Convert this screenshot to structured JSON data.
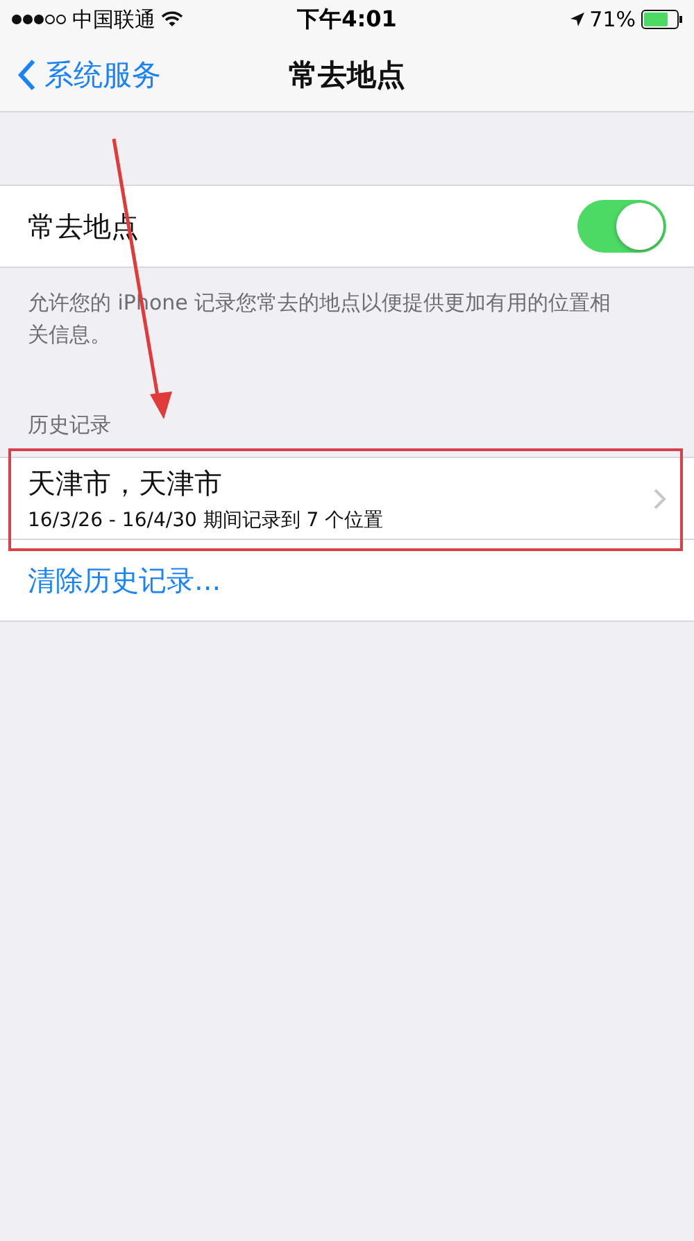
{
  "status_bar": {
    "carrier": "中国联通",
    "time": "下午4:01",
    "battery": "71%"
  },
  "nav": {
    "back": "系统服务",
    "title": "常去地点"
  },
  "toggle_row": {
    "label": "常去地点",
    "on": true
  },
  "description": "允许您的 iPhone 记录您常去的地点以便提供更加有用的位置相关信息。",
  "section_header": "历史记录",
  "history": [
    {
      "title": "天津市，天津市",
      "subtitle": "16/3/26 - 16/4/30 期间记录到 7 个位置"
    }
  ],
  "clear_button": "清除历史记录..."
}
